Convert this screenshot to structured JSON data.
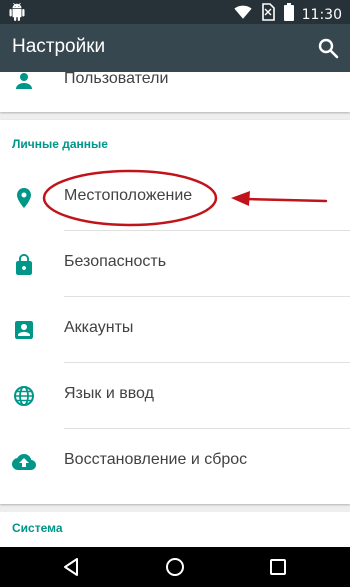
{
  "status_bar": {
    "time": "11:30",
    "icons": [
      "android-notification-icon",
      "wifi-icon",
      "no-sim-icon",
      "battery-icon"
    ]
  },
  "app_bar": {
    "title": "Настройки",
    "search_icon": "search-icon"
  },
  "users_item": {
    "label": "Пользователи",
    "icon": "person-icon"
  },
  "personal_section": {
    "header": "Личные данные",
    "items": [
      {
        "label": "Местоположение",
        "icon": "location-pin-icon"
      },
      {
        "label": "Безопасность",
        "icon": "lock-icon"
      },
      {
        "label": "Аккаунты",
        "icon": "account-box-icon"
      },
      {
        "label": "Язык и ввод",
        "icon": "globe-icon"
      },
      {
        "label": "Восстановление и сброс",
        "icon": "cloud-upload-icon"
      }
    ]
  },
  "system_section": {
    "header": "Система"
  },
  "nav_bar": {
    "buttons": [
      "back-icon",
      "home-icon",
      "recents-icon"
    ]
  },
  "colors": {
    "status_bar": "#263238",
    "app_bar": "#37474f",
    "accent_teal": "#009688",
    "annotation_red": "#c0141a",
    "background": "#eeeeee"
  }
}
